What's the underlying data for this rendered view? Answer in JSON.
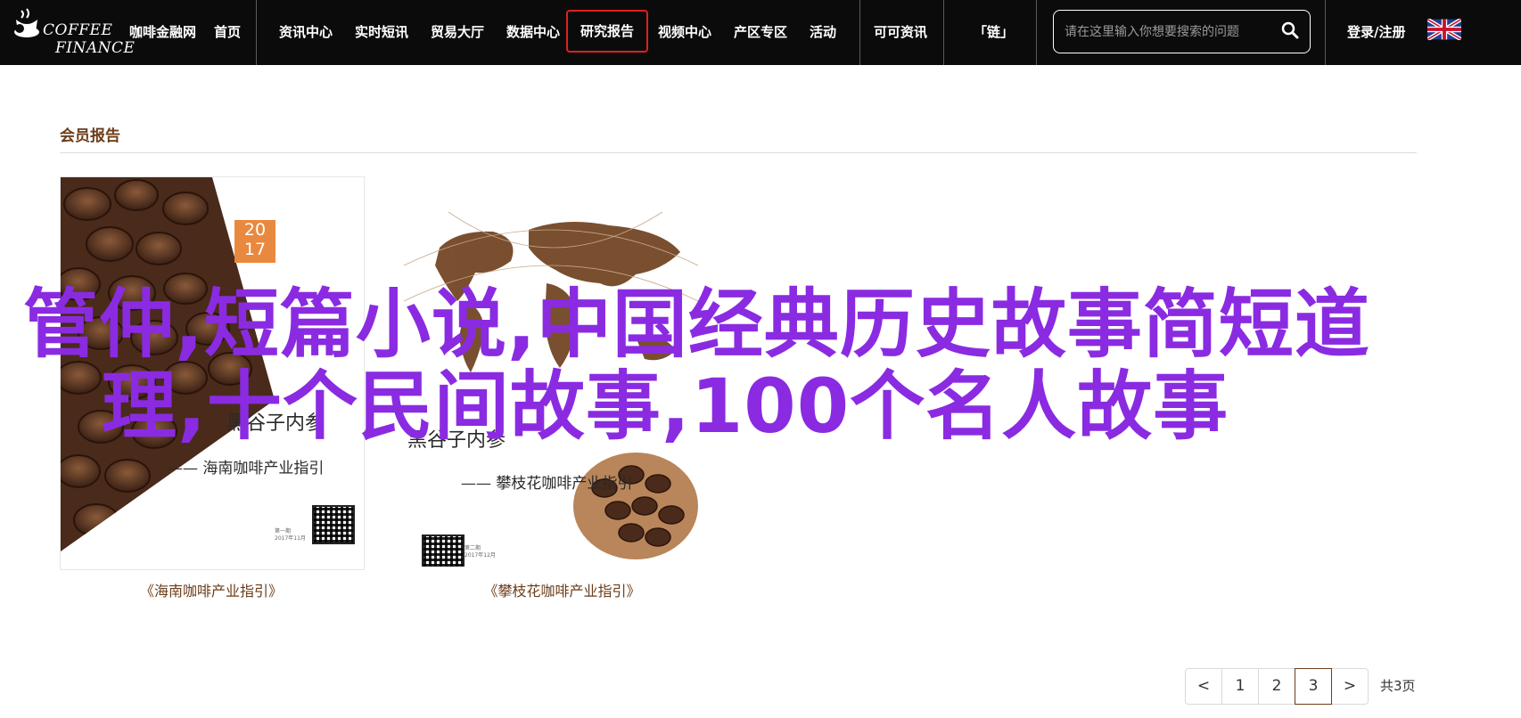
{
  "header": {
    "logo_line1": "COFFEE",
    "logo_line2": "FINANCE",
    "nav": [
      {
        "label": "咖啡金融网"
      },
      {
        "label": "首页"
      },
      {
        "label": "资讯中心"
      },
      {
        "label": "实时短讯"
      },
      {
        "label": "贸易大厅"
      },
      {
        "label": "数据中心"
      },
      {
        "label": "研究报告"
      },
      {
        "label": "视频中心"
      },
      {
        "label": "产区专区"
      },
      {
        "label": "活动"
      },
      {
        "label": "可可资讯"
      },
      {
        "label": "「链」"
      }
    ],
    "active_nav": "研究报告",
    "search_placeholder": "请在这里输入你想要搜索的问题",
    "login_label": "登录/注册",
    "language_flag": "uk-flag-icon"
  },
  "main": {
    "section_title": "会员报告",
    "books": [
      {
        "caption": "《海南咖啡产业指引》",
        "cover_year": "2017",
        "cover_title": "黑谷子内参",
        "cover_subtitle": "—— 海南咖啡产业指引",
        "cover_note1": "第一期",
        "cover_note2": "2017年11月"
      },
      {
        "caption": "《攀枝花咖啡产业指引》",
        "cover_title": "黑谷子内参",
        "cover_subtitle": "—— 攀枝花咖啡产业指引",
        "cover_note1": "第二期",
        "cover_note2": "2017年12月"
      }
    ],
    "headline_line1": "管仲,短篇小说,中国经典历史故事简短道",
    "headline_line2": "理,十个民间故事,100个名人故事"
  },
  "pagination": {
    "prev": "<",
    "pages": [
      "1",
      "2",
      "3"
    ],
    "current": "3",
    "next": ">",
    "total": "共3页"
  },
  "colors": {
    "nav_bg": "#0b0b0b",
    "active_border": "#e21f1f",
    "brown_text": "#6b3d1a",
    "headline": "#8a2be2"
  }
}
